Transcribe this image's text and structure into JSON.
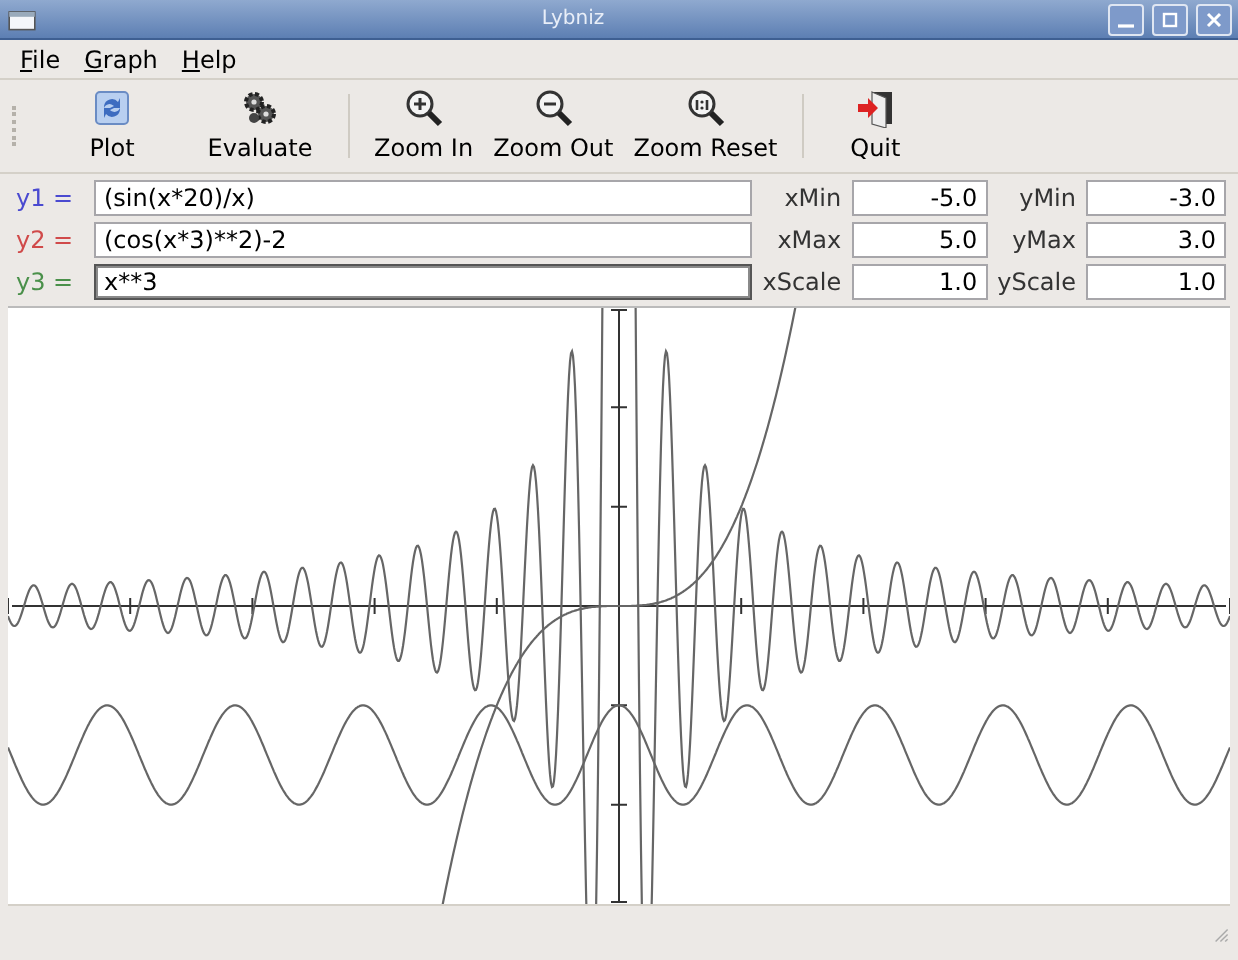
{
  "window": {
    "title": "Lybniz"
  },
  "menu": [
    {
      "label": "File"
    },
    {
      "label": "Graph"
    },
    {
      "label": "Help"
    }
  ],
  "toolbar": [
    {
      "kind": "plot",
      "label": "Plot"
    },
    {
      "kind": "evaluate",
      "label": "Evaluate"
    },
    {
      "kind": "separator"
    },
    {
      "kind": "zoom-in",
      "label": "Zoom In"
    },
    {
      "kind": "zoom-out",
      "label": "Zoom Out"
    },
    {
      "kind": "zoom-reset",
      "label": "Zoom Reset"
    },
    {
      "kind": "separator"
    },
    {
      "kind": "quit",
      "label": "Quit"
    }
  ],
  "functions": [
    {
      "label": "y1 =",
      "color": "#4a4ad0",
      "value": "(sin(x*20)/x)",
      "focused": false
    },
    {
      "label": "y2 =",
      "color": "#d04a4a",
      "value": "(cos(x*3)**2)-2",
      "focused": false
    },
    {
      "label": "y3 =",
      "color": "#4a904a",
      "value": "x**3",
      "focused": true
    }
  ],
  "ranges": [
    [
      {
        "label": "xMin",
        "value": "-5.0"
      },
      {
        "label": "yMin",
        "value": "-3.0"
      }
    ],
    [
      {
        "label": "xMax",
        "value": "5.0"
      },
      {
        "label": "yMax",
        "value": "3.0"
      }
    ],
    [
      {
        "label": "xScale",
        "value": "1.0"
      },
      {
        "label": "yScale",
        "value": "1.0"
      }
    ]
  ]
}
